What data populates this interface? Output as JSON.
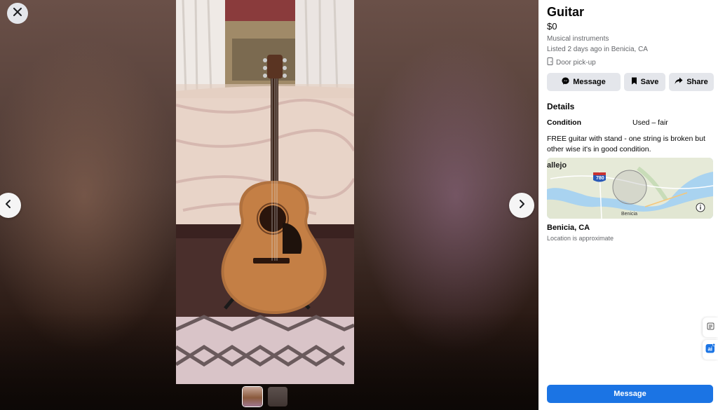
{
  "viewer": {
    "close_icon": "close-icon",
    "prev_icon": "chevron-left-icon",
    "next_icon": "chevron-right-icon",
    "thumbnail_count": 2,
    "active_thumbnail": 1
  },
  "listing": {
    "title": "Guitar",
    "price": "$0",
    "category": "Musical instruments",
    "listed": "Listed 2 days ago in Benicia, CA",
    "pickup": "Door pick-up"
  },
  "actions": {
    "message_label": "Message",
    "save_label": "Save",
    "share_label": "Share"
  },
  "details": {
    "heading": "Details",
    "condition_label": "Condition",
    "condition_value": "Used – fair",
    "description": "FREE guitar with stand - one string is broken but other wise it's in good condition."
  },
  "map": {
    "city_label": "allejo",
    "highway_label": "780",
    "town_label": "Benicia",
    "info_icon": "info-icon"
  },
  "location": {
    "name": "Benicia, CA",
    "note": "Location is approximate"
  },
  "bottom": {
    "message_label": "Message"
  },
  "colors": {
    "accent": "#1b74e4",
    "button_bg": "#e4e6eb",
    "secondary_text": "#65676b",
    "map_water": "#a9d3f0",
    "map_land": "#e6ead8"
  }
}
